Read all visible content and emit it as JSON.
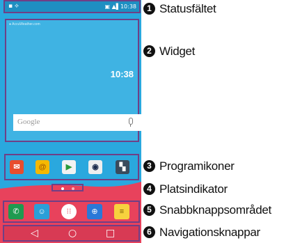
{
  "phone": {
    "statusbar": {
      "left_icons": "▪ ⟡",
      "right_text": "▣ ▲▌10:38"
    },
    "widget": {
      "source": "● AccuWeather.com",
      "time": "10:38"
    },
    "search": {
      "placeholder": "Google"
    },
    "apps": [
      {
        "name": "mail-app-icon",
        "glyph": "✉",
        "bg": "#e84d2e"
      },
      {
        "name": "email-app-icon",
        "glyph": "@",
        "bg": "#f5b800"
      },
      {
        "name": "play-store-icon",
        "glyph": "▶",
        "bg": "#f2f2f2"
      },
      {
        "name": "camera-app-icon",
        "glyph": "◉",
        "bg": "#eeeeee"
      },
      {
        "name": "app-grid-icon",
        "glyph": "▚",
        "bg": "#3a4b5c"
      }
    ],
    "dock": [
      {
        "name": "phone-icon",
        "glyph": "✆",
        "bg": "#1f9a50"
      },
      {
        "name": "contacts-icon",
        "glyph": "☺",
        "bg": "#2a9fd8"
      },
      {
        "name": "apps-drawer-icon",
        "glyph": "⁝⁝",
        "bg": "#e8425c"
      },
      {
        "name": "browser-icon",
        "glyph": "⊕",
        "bg": "#2a78d8"
      },
      {
        "name": "messaging-icon",
        "glyph": "≡",
        "bg": "#f7d23e"
      }
    ],
    "nav": {
      "back": "◁",
      "home": "○",
      "recent": "□"
    }
  },
  "callouts": [
    {
      "num": "1",
      "label": "Statusfältet"
    },
    {
      "num": "2",
      "label": "Widget"
    },
    {
      "num": "3",
      "label": "Programikoner"
    },
    {
      "num": "4",
      "label": "Platsindikator"
    },
    {
      "num": "5",
      "label": "Snabbknappsområdet"
    },
    {
      "num": "6",
      "label": "Navigationsknappar"
    }
  ]
}
